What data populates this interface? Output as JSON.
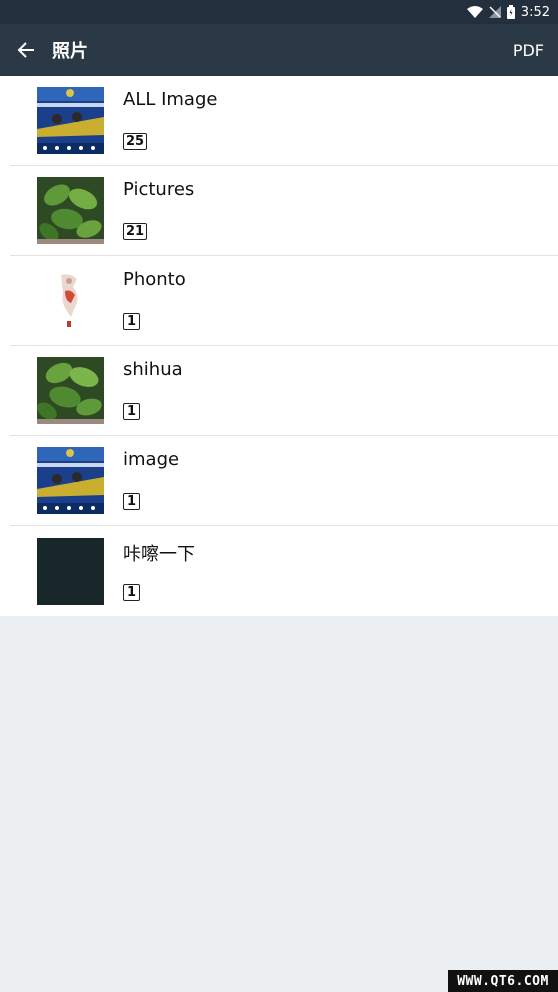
{
  "statusbar": {
    "time": "3:52"
  },
  "appbar": {
    "title": "照片",
    "action": "PDF"
  },
  "albums": [
    {
      "name": "ALL Image",
      "count": "25",
      "thumb": "poster"
    },
    {
      "name": "Pictures",
      "count": "21",
      "thumb": "plant"
    },
    {
      "name": "Phonto",
      "count": "1",
      "thumb": "sketch"
    },
    {
      "name": "shihua",
      "count": "1",
      "thumb": "plant"
    },
    {
      "name": "image",
      "count": "1",
      "thumb": "poster"
    },
    {
      "name": "咔嚓一下",
      "count": "1",
      "thumb": "dark"
    }
  ],
  "watermark": "WWW.QT6.COM",
  "colors": {
    "statusbar": "#232f3c",
    "appbar": "#2b3845",
    "background": "#eceff1"
  }
}
